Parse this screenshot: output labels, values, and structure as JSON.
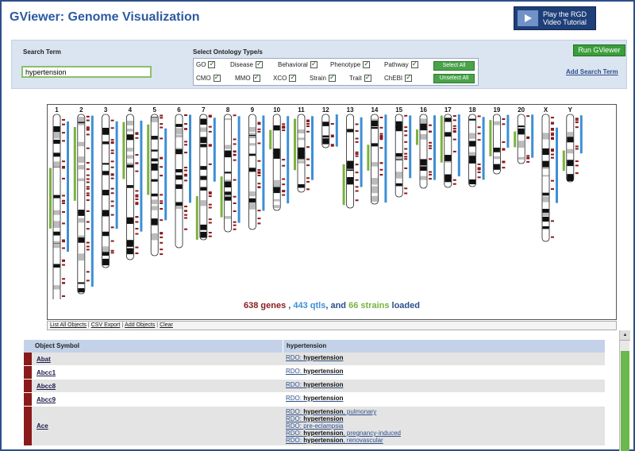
{
  "title": "GViewer: Genome Visualization",
  "video": {
    "line1": "Play the RGD",
    "line2": "Video Tutorial"
  },
  "search": {
    "label": "Search Term",
    "value": "hypertension"
  },
  "ontology": {
    "label": "Select Ontology Type/s",
    "row1": [
      "GO",
      "Disease",
      "Behavioral",
      "Phenotype",
      "Pathway"
    ],
    "row2": [
      "CMO",
      "MMO",
      "XCO",
      "Strain",
      "Trait",
      "ChEBI"
    ],
    "select_all": "Select All",
    "unselect_all": "Unselect All"
  },
  "run_button": "Run GViewer",
  "add_search_term": "Add Search Term",
  "chromosomes": [
    "1",
    "2",
    "3",
    "4",
    "5",
    "6",
    "7",
    "8",
    "9",
    "10",
    "11",
    "12",
    "13",
    "14",
    "15",
    "16",
    "17",
    "18",
    "19",
    "20",
    "X",
    "Y"
  ],
  "loaded": {
    "genes": "638 genes",
    "sep1": " , ",
    "qtls": "443 qtls",
    "sep2": ", and ",
    "strains": "66 strains",
    "suffix": " loaded"
  },
  "links": [
    "List All Objects",
    "CSV Export",
    "Add Objects",
    "Clear"
  ],
  "table": {
    "col1": "Object Symbol",
    "col2": "hypertension",
    "rows": [
      {
        "symbol": "Abat",
        "terms": [
          {
            "prefix": "RDO: ",
            "bold": "hypertension",
            "suffix": ""
          }
        ]
      },
      {
        "symbol": "Abcc1",
        "terms": [
          {
            "prefix": "RDO: ",
            "bold": "hypertension",
            "suffix": ""
          }
        ]
      },
      {
        "symbol": "Abcc8",
        "terms": [
          {
            "prefix": "RDO: ",
            "bold": "hypertension",
            "suffix": ""
          }
        ]
      },
      {
        "symbol": "Abcc9",
        "terms": [
          {
            "prefix": "RDO: ",
            "bold": "hypertension",
            "suffix": ""
          }
        ]
      },
      {
        "symbol": "Ace",
        "terms": [
          {
            "prefix": "RDO: ",
            "bold": "hypertension",
            "suffix": ", pulmonary"
          },
          {
            "prefix": "RDO: ",
            "bold": "hypertension",
            "suffix": ""
          },
          {
            "prefix": "RDO: ",
            "bold": "",
            "suffix": "pre-eclampsia"
          },
          {
            "prefix": "RDO: ",
            "bold": "hypertension",
            "suffix": ", pregnancy-induced"
          },
          {
            "prefix": "RDO: ",
            "bold": "hypertension",
            "suffix": ", renovascular"
          }
        ]
      }
    ]
  },
  "colors": {
    "gene": "#8b1a1a",
    "qtl": "#3d8fd6",
    "strain": "#79b33c",
    "accent": "#2d4f8a"
  }
}
